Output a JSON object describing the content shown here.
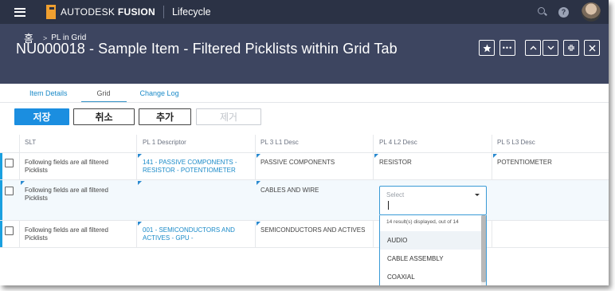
{
  "topbar": {
    "brand_prefix": "AUTODESK",
    "brand_name": "FUSION",
    "app_name": "Lifecycle",
    "help_label": "?"
  },
  "header": {
    "home_icon_text": "홈",
    "breadcrumb_sep": ">",
    "breadcrumb_item": "PL in Grid",
    "title": "NU000018 - Sample Item - Filtered Picklists within Grid Tab",
    "more_label": "•••"
  },
  "tabs": [
    {
      "label": "Item Details",
      "active": false
    },
    {
      "label": "Grid",
      "active": true
    },
    {
      "label": "Change Log",
      "active": false
    }
  ],
  "actions": {
    "save": "저장",
    "cancel": "취소",
    "add": "추가",
    "remove": "제거"
  },
  "grid": {
    "columns": [
      "SLT",
      "PL 1 Descriptor",
      "PL 3 L1 Desc",
      "PL 4 L2 Desc",
      "PL 5 L3 Desc"
    ],
    "rows": [
      {
        "slt": "Following fields are all filtered Picklists",
        "pl1": "141 - PASSIVE COMPONENTS - RESISTOR - POTENTIOMETER",
        "pl3": "PASSIVE COMPONENTS",
        "pl4": "RESISTOR",
        "pl5": "POTENTIOMETER"
      },
      {
        "slt": "Following fields are all filtered Picklists",
        "pl1": "",
        "pl3": "CABLES AND WIRE",
        "pl4": "",
        "pl5": ""
      },
      {
        "slt": "Following fields are all filtered Picklists",
        "pl1": "001 - SEMICONDUCTORS AND ACTIVES - GPU -",
        "pl3": "SEMICONDUCTORS AND ACTIVES",
        "pl4": "",
        "pl5": ""
      }
    ]
  },
  "dropdown": {
    "placeholder": "Select",
    "count_text": "14 result(s) displayed, out of 14",
    "options": [
      "AUDIO",
      "CABLE ASSEMBLY",
      "COAXIAL"
    ]
  }
}
